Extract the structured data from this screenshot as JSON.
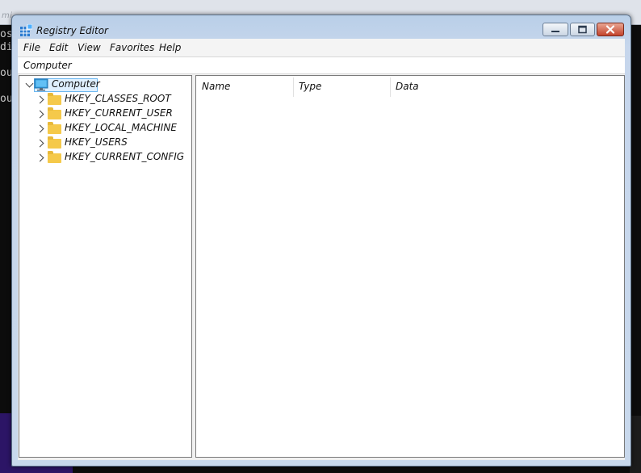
{
  "background": {
    "title_fragment": "mi",
    "console_lines": [
      "osc",
      "dic",
      "our",
      "our"
    ]
  },
  "window": {
    "title": "Registry Editor",
    "icon": "registry-icon",
    "controls": [
      "minimize-icon",
      "maximize-icon",
      "close-icon"
    ]
  },
  "menu": {
    "file": "File",
    "edit": "Edit",
    "view": "View",
    "favorites": "Favorites",
    "help": "Help"
  },
  "address": {
    "path": "Computer"
  },
  "tree": {
    "root": {
      "label": "Computer",
      "icon": "computer-icon",
      "expanded": true,
      "selected": true
    },
    "children": [
      {
        "label": "HKEY_CLASSES_ROOT",
        "icon": "folder-icon"
      },
      {
        "label": "HKEY_CURRENT_USER",
        "icon": "folder-icon"
      },
      {
        "label": "HKEY_LOCAL_MACHINE",
        "icon": "folder-icon"
      },
      {
        "label": "HKEY_USERS",
        "icon": "folder-icon"
      },
      {
        "label": "HKEY_CURRENT_CONFIG",
        "icon": "folder-icon"
      }
    ]
  },
  "list": {
    "columns": [
      "Name",
      "Type",
      "Data"
    ],
    "rows": []
  },
  "colors": {
    "selection_bg": "#dff0ff",
    "selection_border": "#6cb7f0",
    "folder": "#f5c94a",
    "close_button": "#c3432c"
  }
}
